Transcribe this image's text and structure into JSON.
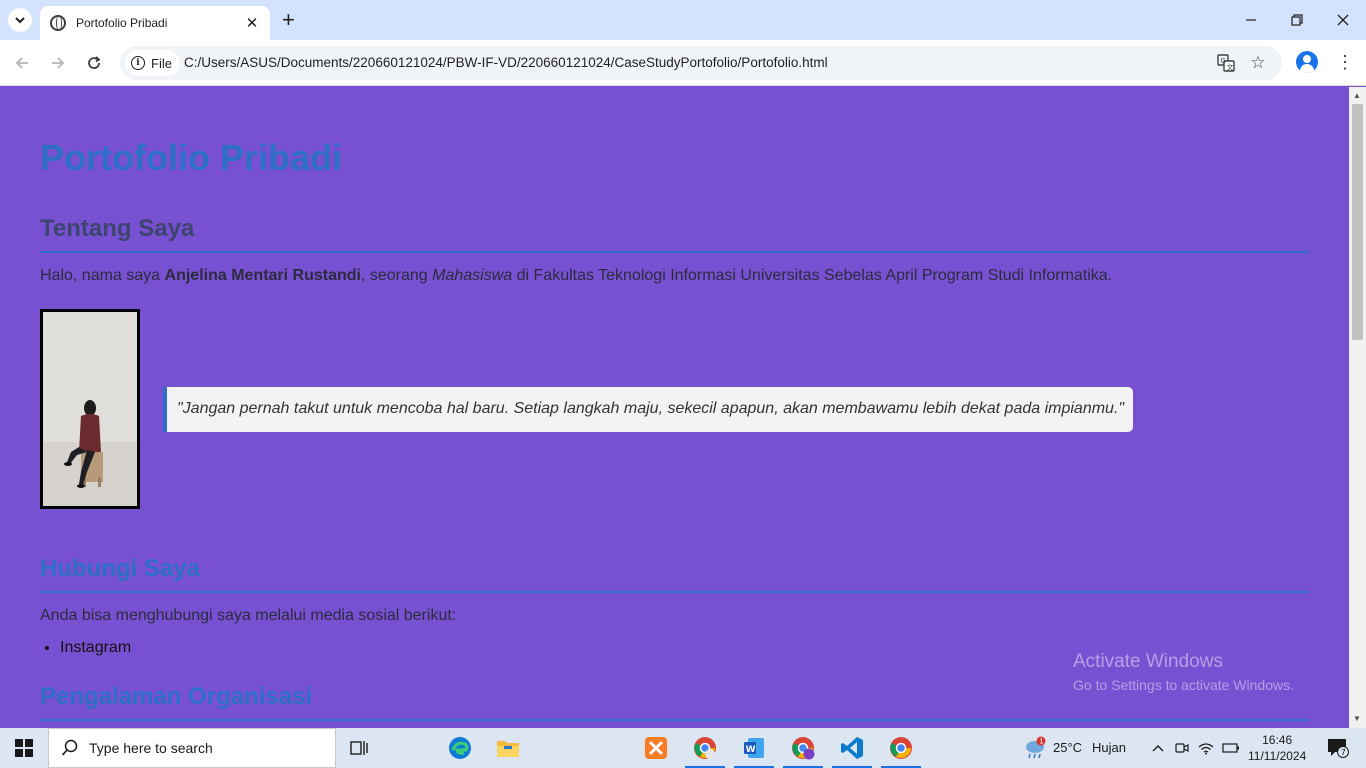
{
  "browser": {
    "tab_title": "Portofolio Pribadi",
    "url_chip": "File",
    "url": "C:/Users/ASUS/Documents/220660121024/PBW-IF-VD/220660121024/CaseStudyPortofolio/Portofolio.html"
  },
  "page": {
    "title": "Portofolio Pribadi",
    "about": {
      "heading": "Tentang Saya",
      "text_1": "Halo, nama saya ",
      "name": "Anjelina Mentari Rustandi",
      "text_2": ", seorang ",
      "role": "Mahasiswa",
      "text_3": " di Fakultas Teknologi Informasi Universitas Sebelas April Program Studi Informatika.",
      "quote": "\"Jangan pernah takut untuk mencoba hal baru. Setiap langkah maju, sekecil apapun, akan membawamu lebih dekat pada impianmu.\""
    },
    "contact": {
      "heading": "Hubungi Saya",
      "text": "Anda bisa menghubungi saya melalui media sosial berikut:",
      "items": [
        "Instagram"
      ]
    },
    "organization": {
      "heading": "Pengalaman Organisasi"
    }
  },
  "watermark": {
    "title": "Activate Windows",
    "subtitle": "Go to Settings to activate Windows."
  },
  "taskbar": {
    "search_placeholder": "Type here to search",
    "weather_temp": "25°C",
    "weather_desc": "Hujan",
    "weather_badge": "1",
    "time": "16:46",
    "date": "11/11/2024",
    "notification_count": "7"
  },
  "colors": {
    "page_background": "#7851d2",
    "heading_blue": "#2d6fc6",
    "about_heading": "#3c4470",
    "tab_strip": "#d3e3fd"
  }
}
